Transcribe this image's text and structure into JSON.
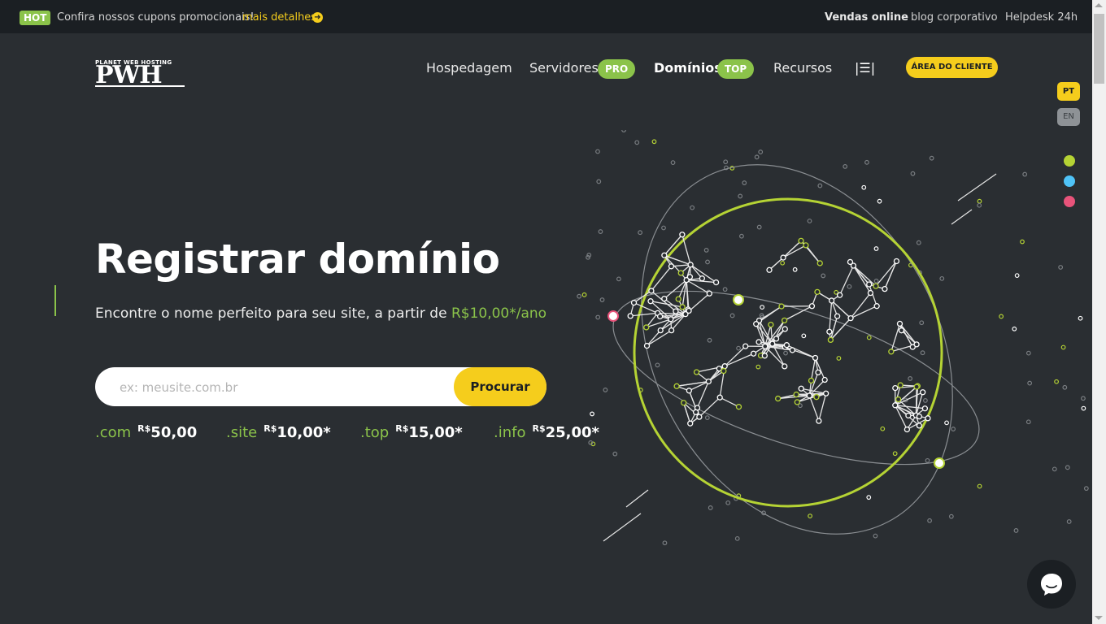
{
  "topbar": {
    "hot_badge": "HOT",
    "promo_text": "Confira nossos cupons promocionais!",
    "promo_link": "mais detalhes",
    "links": [
      "Vendas online",
      "blog corporativo",
      "Helpdesk 24h"
    ]
  },
  "logo": {
    "small_text": "PLANET WEB HOSTING",
    "main_text": "PWH"
  },
  "nav": {
    "items": [
      {
        "label": "Hospedagem"
      },
      {
        "label": "Servidores",
        "badge": "PRO"
      },
      {
        "label": "Domínios",
        "badge": "TOP"
      },
      {
        "label": "Recursos"
      }
    ],
    "menu_icon": "|☰|",
    "client_button": "ÁREA DO CLIENTE"
  },
  "side": {
    "languages": [
      "PT",
      "EN"
    ],
    "theme_colors": [
      "#b5d334",
      "#4fc3f7",
      "#e8537a"
    ]
  },
  "hero": {
    "title": "Registrar domínio",
    "subtitle": "Encontre o nome perfeito para seu site, a partir de",
    "subtitle_price": "R$10,00*/ano",
    "search_placeholder": "ex: meusite.com.br",
    "search_button": "Procurar"
  },
  "tlds": [
    {
      "name": ".com",
      "currency": "R$",
      "price": "50,00"
    },
    {
      "name": ".site",
      "currency": "R$",
      "price": "10,00*"
    },
    {
      "name": ".top",
      "currency": "R$",
      "price": "15,00*"
    },
    {
      "name": ".info",
      "currency": "R$",
      "price": "25,00*"
    }
  ],
  "colors": {
    "accent_green": "#8bc34a",
    "accent_yellow": "#f5cd1c",
    "background": "#2a2e32"
  },
  "icons": {
    "promo_arrow": "arrow-circle-right-icon",
    "chat": "chat-bubble-icon",
    "globe": "globe-network-illustration"
  }
}
